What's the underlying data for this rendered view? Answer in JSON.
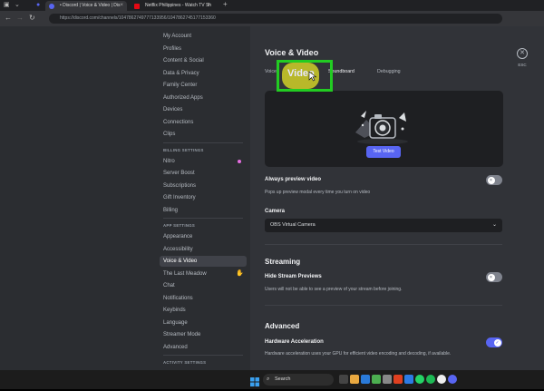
{
  "browser": {
    "tabs": [
      {
        "title": "• Discord | Voice & Video | Dis",
        "favicon_color": "#5865f2"
      },
      {
        "title": "Netflix Philippines - Watch TV Sh",
        "favicon_color": "#e50914"
      }
    ],
    "url": "https://discord.com/channels/1047862749777133956/1047862745177153360"
  },
  "sidebar": {
    "user_items": [
      "My Account",
      "Profiles",
      "Content & Social",
      "Data & Privacy",
      "Family Center",
      "Authorized Apps",
      "Devices",
      "Connections",
      "Clips"
    ],
    "billing_header": "BILLING SETTINGS",
    "billing_items": [
      "Nitro",
      "Server Boost",
      "Subscriptions",
      "Gift Inventory",
      "Billing"
    ],
    "app_header": "APP SETTINGS",
    "app_items": [
      "Appearance",
      "Accessibility",
      "Voice & Video",
      "The Last Meadow",
      "Chat",
      "Notifications",
      "Keybinds",
      "Language",
      "Streamer Mode",
      "Advanced"
    ],
    "activity_header": "ACTIVITY SETTINGS",
    "active_item": "Voice & Video"
  },
  "main": {
    "title": "Voice & Video",
    "close_label": "ESC",
    "tabs": [
      "Voice",
      "Video",
      "Soundboard",
      "Debugging"
    ],
    "active_tab": "Video",
    "test_video_button": "Test Video",
    "always_preview": {
      "label": "Always preview video",
      "desc": "Pops up preview modal every time you turn on video",
      "enabled": false
    },
    "camera": {
      "label": "Camera",
      "selected": "OBS Virtual Camera"
    },
    "streaming": {
      "heading": "Streaming",
      "hide_previews": {
        "label": "Hide Stream Previews",
        "desc": "Users will not be able to see a preview of your stream before joining.",
        "enabled": false
      }
    },
    "advanced": {
      "heading": "Advanced",
      "hw_accel": {
        "label": "Hardware Acceleration",
        "desc": "Hardware acceleration uses your GPU for efficient video encoding and decoding, if available.",
        "enabled": true
      }
    }
  },
  "taskbar": {
    "search_label": "Search"
  },
  "colors": {
    "accent": "#5865f2",
    "highlight_box": "#22cc22",
    "sidebar_bg": "#2b2d31",
    "content_bg": "#313338"
  }
}
